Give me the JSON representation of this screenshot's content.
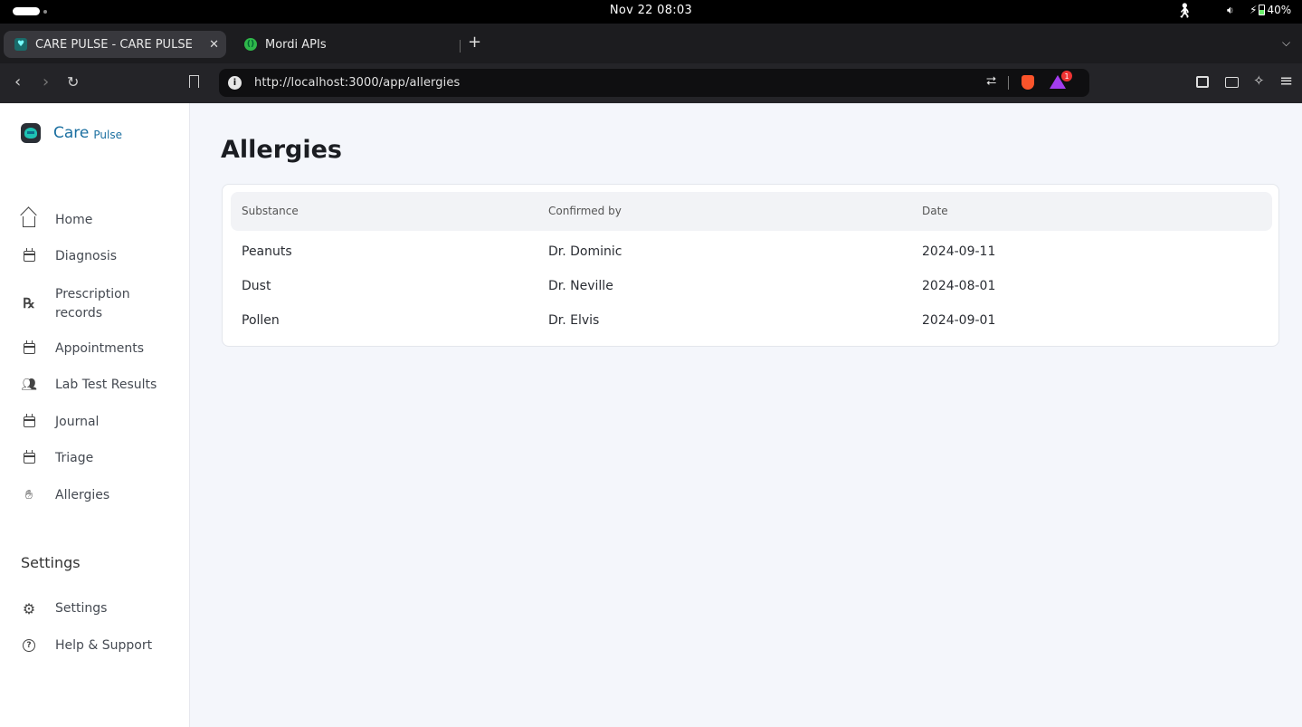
{
  "os": {
    "clock": "Nov 22  08:03",
    "battery": "40%",
    "icons": [
      "accessibility-icon",
      "volume-icon",
      "battery-icon"
    ]
  },
  "browser": {
    "tabs": [
      {
        "title": "CARE PULSE - CARE PULSE",
        "active": true
      },
      {
        "title": "Mordi APIs",
        "active": false
      }
    ],
    "new_tab": "+",
    "url": "http://localhost:3000/app/allergies",
    "notification_count": "1"
  },
  "sidebar": {
    "brand": {
      "care": "Care",
      "pulse": "Pulse"
    },
    "items": [
      {
        "label": "Home",
        "icon": "home-icon"
      },
      {
        "label": "Diagnosis",
        "icon": "calendar-icon"
      },
      {
        "label": "Prescription records",
        "icon": "rx-icon"
      },
      {
        "label": "Appointments",
        "icon": "calendar-icon"
      },
      {
        "label": "Lab Test Results",
        "icon": "users-icon"
      },
      {
        "label": "Journal",
        "icon": "calendar-icon"
      },
      {
        "label": "Triage",
        "icon": "calendar-icon"
      },
      {
        "label": "Allergies",
        "icon": "hand-icon"
      }
    ],
    "settings_title": "Settings",
    "settings_items": [
      {
        "label": "Settings",
        "icon": "gear-icon"
      },
      {
        "label": "Help & Support",
        "icon": "help-icon"
      }
    ]
  },
  "main": {
    "title": "Allergies",
    "table": {
      "headers": [
        "Substance",
        "Confirmed by",
        "Date"
      ],
      "rows": [
        [
          "Peanuts",
          "Dr. Dominic",
          "2024-09-11"
        ],
        [
          "Dust",
          "Dr. Neville",
          "2024-08-01"
        ],
        [
          "Pollen",
          "Dr. Elvis",
          "2024-09-01"
        ]
      ]
    }
  },
  "colors": {
    "brand": "#1b6fa0",
    "page_bg": "#f4f6fb",
    "browser_bg": "#1c1c1f"
  }
}
